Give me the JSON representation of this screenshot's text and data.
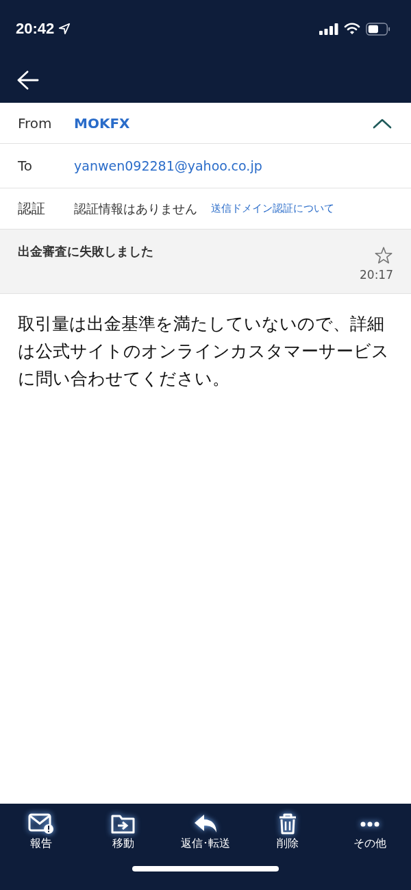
{
  "status_bar": {
    "time": "20:42"
  },
  "header": {
    "rows": [
      {
        "kind": "from",
        "label": "From",
        "value": "MOKFX",
        "expanded": true
      },
      {
        "kind": "to",
        "label": "To",
        "value": "yanwen092281@yahoo.co.jp"
      },
      {
        "kind": "auth",
        "label": "認証",
        "value": "認証情報はありません",
        "link": "送信ドメイン認証について"
      }
    ]
  },
  "subject": {
    "text": "出金審査に失敗しました",
    "starred": false,
    "time": "20:17"
  },
  "body": "取引量は出金基準を満たしていないので、詳細は公式サイトのオンラインカスタマーサービスに問い合わせてください。",
  "toolbar": [
    {
      "kind": "report",
      "label": "報告"
    },
    {
      "kind": "move",
      "label": "移動"
    },
    {
      "kind": "reply",
      "label": "返信･転送"
    },
    {
      "kind": "delete",
      "label": "削除"
    },
    {
      "kind": "more",
      "label": "その他"
    }
  ]
}
